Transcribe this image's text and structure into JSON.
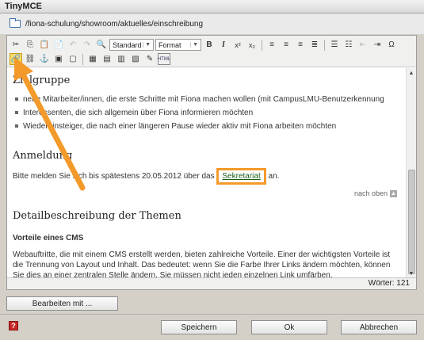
{
  "window": {
    "title": "TinyMCE"
  },
  "path": {
    "text": "/fiona-schulung/showroom/aktuelles/einschreibung"
  },
  "toolbar": {
    "format_select": "Standard",
    "style_select": "Format",
    "buttons_row1": [
      "cut-icon",
      "copy-icon",
      "paste-icon",
      "undo-icon",
      "redo-icon",
      "find-icon"
    ],
    "bold": "B",
    "italic": "I",
    "sup": "x²",
    "sub": "x₂",
    "html_label": "HTML",
    "omega": "Ω"
  },
  "content": {
    "heading_zielgruppe": "Zielgruppe",
    "list": [
      "neue Mitarbeiter/innen, die erste Schritte mit Fiona machen wollen (mit CampusLMU-Benutzerkennung",
      "Interessenten, die sich allgemein über Fiona informieren möchten",
      "Wiedereinsteiger, die nach einer längeren Pause wieder aktiv mit Fiona arbeiten möchten"
    ],
    "heading_anmeldung": "Anmeldung",
    "anmeldung_text_before": "Bitte melden Sie sich bis spätestens 20.05.2012 über das",
    "anmeldung_link": "Sekretariat",
    "anmeldung_text_after": "an.",
    "nach_oben": "nach oben",
    "heading_detail": "Detailbeschreibung der Themen",
    "subheading_cms": "Vorteile eines CMS",
    "paragraph": "Webauftritte, die mit einem CMS erstellt werden, bieten zahlreiche Vorteile. Einer der wichtigsten Vorteile ist die Trennung von Layout und Inhalt. Das bedeutet: wenn Sie die Farbe Ihrer Links ändern möchten, können Sie dies an einer zentralen Stelle ändern. Sie müssen nicht jeden einzelnen Link umfärben."
  },
  "status": {
    "word_count": "Wörter: 121"
  },
  "buttons": {
    "edit_with": "Bearbeiten mit ...",
    "save": "Speichern",
    "ok": "Ok",
    "cancel": "Abbrechen"
  },
  "colors": {
    "highlight": "#f39a2a",
    "link": "#1a5e1a"
  }
}
